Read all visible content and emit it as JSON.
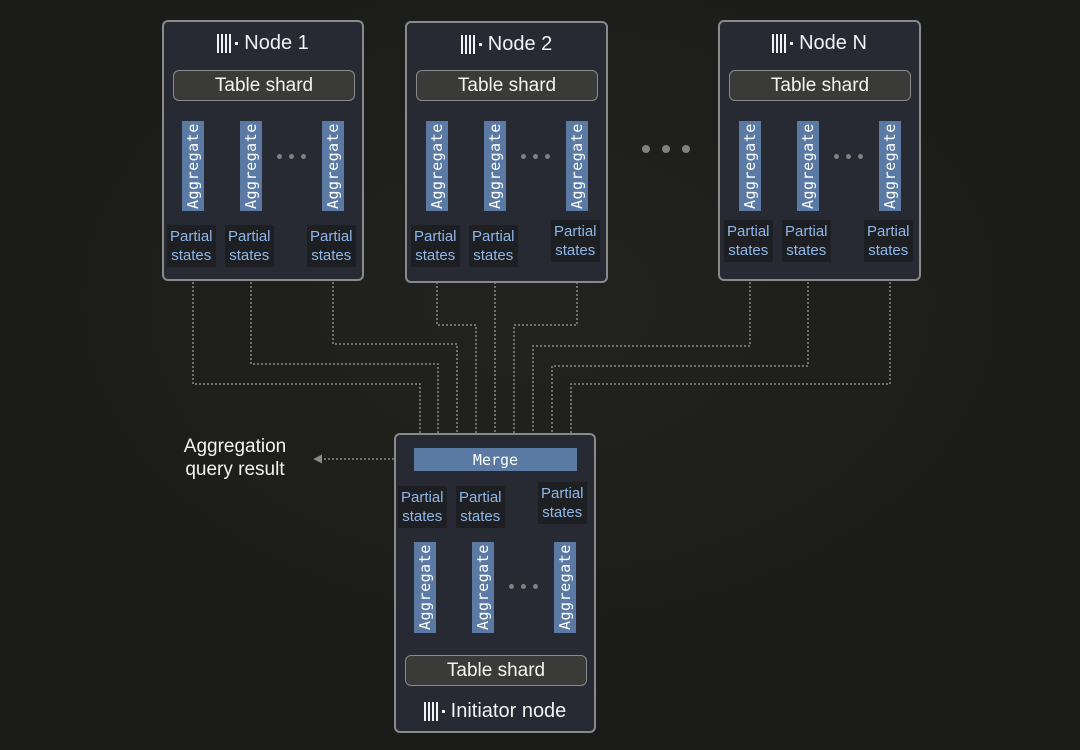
{
  "diagram": {
    "nodes": [
      {
        "title": "Node 1",
        "shard": "Table shard",
        "aggregates": [
          "Aggregate",
          "Aggregate",
          "Aggregate"
        ],
        "partials": [
          "Partial states",
          "Partial states",
          "Partial states"
        ]
      },
      {
        "title": "Node 2",
        "shard": "Table shard",
        "aggregates": [
          "Aggregate",
          "Aggregate",
          "Aggregate"
        ],
        "partials": [
          "Partial states",
          "Partial states",
          "Partial states"
        ]
      },
      {
        "title": "Node N",
        "shard": "Table shard",
        "aggregates": [
          "Aggregate",
          "Aggregate",
          "Aggregate"
        ],
        "partials": [
          "Partial states",
          "Partial states",
          "Partial states"
        ]
      }
    ],
    "initiator": {
      "title": "Initiator node",
      "merge": "Merge",
      "shard": "Table shard",
      "aggregates": [
        "Aggregate",
        "Aggregate",
        "Aggregate"
      ],
      "partials": [
        "Partial states",
        "Partial states",
        "Partial states"
      ]
    },
    "result_label_line1": "Aggregation",
    "result_label_line2": "query result",
    "partial_line1": "Partial",
    "partial_line2": "states",
    "logo_icon": "clickhouse-logo-icon",
    "colors": {
      "background": "#1b1b19",
      "node_fill": "#272a33",
      "aggregate_fill": "#5a7aa3",
      "partial_text": "#8fb8ea",
      "connector": "#8a8a8a"
    }
  }
}
